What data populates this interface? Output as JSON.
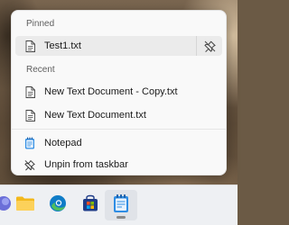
{
  "jumplist": {
    "pinned_header": "Pinned",
    "pinned_items": [
      {
        "label": "Test1.txt",
        "icon": "text-document-icon"
      }
    ],
    "recent_header": "Recent",
    "recent_items": [
      {
        "label": "New Text Document - Copy.txt",
        "icon": "text-document-icon"
      },
      {
        "label": "New Text Document.txt",
        "icon": "text-document-icon"
      }
    ],
    "actions": [
      {
        "label": "Notepad",
        "icon": "notepad-icon"
      },
      {
        "label": "Unpin from taskbar",
        "icon": "unpin-icon"
      }
    ]
  },
  "taskbar": {
    "apps": [
      {
        "name": "Copilot",
        "icon": "copilot-icon"
      },
      {
        "name": "File Explorer",
        "icon": "file-explorer-icon"
      },
      {
        "name": "Microsoft Edge",
        "icon": "edge-icon"
      },
      {
        "name": "Microsoft Store",
        "icon": "store-icon"
      },
      {
        "name": "Notepad",
        "icon": "notepad-icon",
        "active": true
      }
    ]
  },
  "colors": {
    "panel_bg": "#f9f9f9",
    "selected_row": "#ebebeb",
    "taskbar_bg": "#eef0f3",
    "notepad_blue": "#2f8de4",
    "folder_yellow": "#f3b81b",
    "edge_blue": "#0f7cc7",
    "edge_green": "#4fbf5d"
  }
}
